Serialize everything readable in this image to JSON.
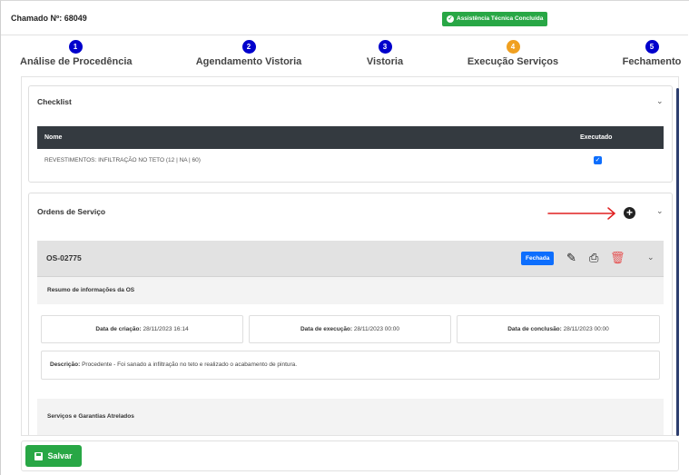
{
  "header": {
    "ticket_label": "Chamado Nº: 68049",
    "status_badge": "Assistência Técnica Concluída"
  },
  "steps": [
    {
      "num": "1",
      "label": "Análise de Procedência",
      "color": "#0000cc"
    },
    {
      "num": "2",
      "label": "Agendamento Vistoria",
      "color": "#0000cc"
    },
    {
      "num": "3",
      "label": "Vistoria",
      "color": "#0000cc"
    },
    {
      "num": "4",
      "label": "Execução Serviços",
      "color": "#f0a020"
    },
    {
      "num": "5",
      "label": "Fechamento",
      "color": "#0000cc"
    }
  ],
  "checklist": {
    "title": "Checklist",
    "columns": [
      "Nome",
      "Executado"
    ],
    "rows": [
      {
        "name": "REVESTIMENTOS: INFILTRAÇÃO NO TETO (12 | NA | 60)",
        "executed": true
      }
    ]
  },
  "service_orders": {
    "title": "Ordens de Serviço",
    "order": {
      "id": "OS-02775",
      "status_badge": "Fechada",
      "summary_title": "Resumo de informações da OS",
      "created_label": "Data de criação:",
      "created_value": "28/11/2023 16:14",
      "executed_label": "Data de execução:",
      "executed_value": "28/11/2023 00:00",
      "concluded_label": "Data de conclusão:",
      "concluded_value": "28/11/2023 00:00",
      "description_label": "Descrição:",
      "description_value": "Procedente - Foi sanado a infiltração no teto e realizado o acabamento de pintura.",
      "services_title": "Serviços e Garantias Atrelados"
    }
  },
  "footer": {
    "save_label": "Salvar"
  },
  "icons": {
    "chevron": "chevron-down-icon",
    "plus": "plus-circle-icon",
    "edit": "pencil-icon",
    "print": "printer-icon",
    "delete": "trash-icon",
    "save": "floppy-disk-icon"
  },
  "colors": {
    "success": "#28a745",
    "primary": "#0d6efd",
    "step_active": "#f0a020",
    "step_default": "#0000cc",
    "danger": "#e55353",
    "annotation": "#e02020"
  }
}
